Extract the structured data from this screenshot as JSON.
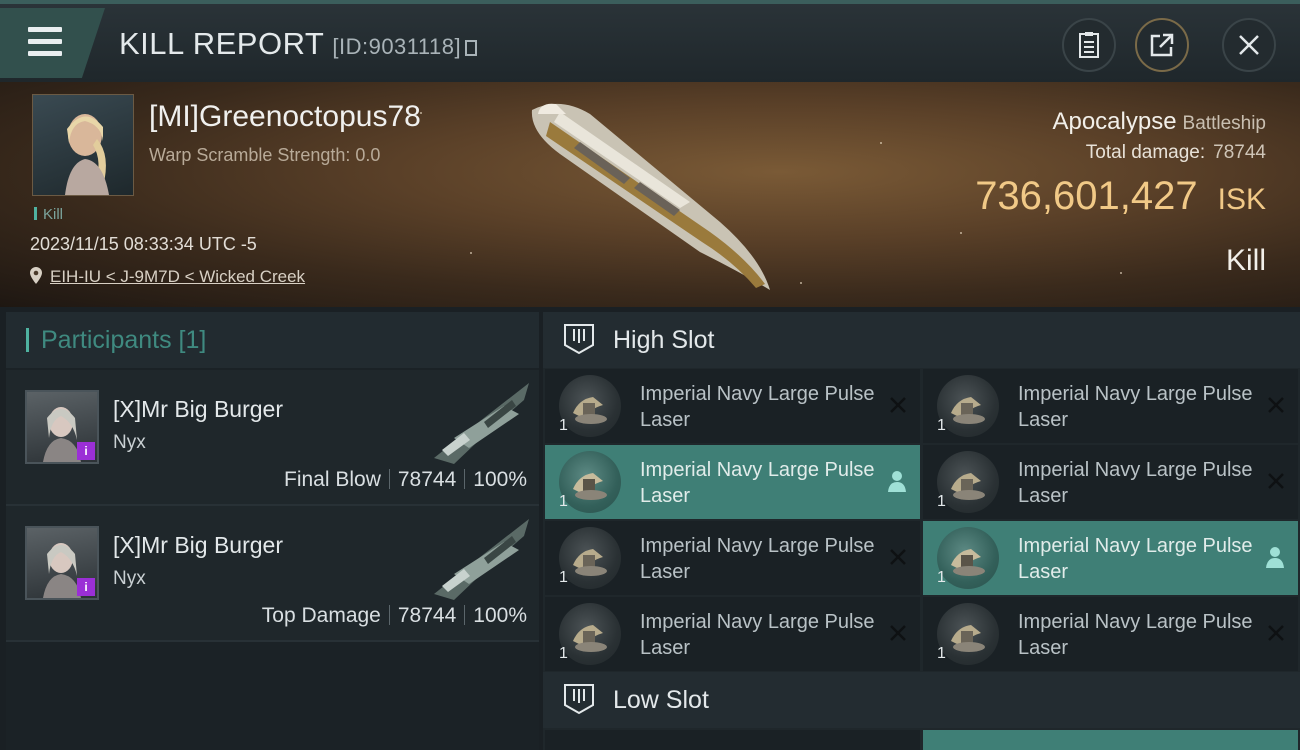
{
  "header": {
    "title": "KILL REPORT",
    "report_id": "[ID:9031118]"
  },
  "victim": {
    "name": "[MI]Greenoctopus78",
    "warp_scramble": "Warp Scramble Strength: 0.0",
    "kill_tag": "Kill",
    "datetime": "2023/11/15 08:33:34 UTC -5",
    "location": "EIH-IU < J-9M7D < Wicked Creek",
    "ship_name": "Apocalypse",
    "ship_class": "Battleship",
    "total_damage_label": "Total damage:",
    "total_damage": "78744",
    "isk_value": "736,601,427",
    "isk_unit": "ISK",
    "result": "Kill"
  },
  "participants": {
    "title": "Participants [1]",
    "rows": [
      {
        "name": "[X]Mr Big Burger",
        "ship": "Nyx",
        "role": "Final Blow",
        "damage": "78744",
        "percent": "100%"
      },
      {
        "name": "[X]Mr Big Burger",
        "ship": "Nyx",
        "role": "Top Damage",
        "damage": "78744",
        "percent": "100%"
      }
    ]
  },
  "high_slot": {
    "title": "High Slot",
    "modules": [
      {
        "qty": "1",
        "name": "Imperial Navy Large Pulse Laser",
        "state": "destroyed"
      },
      {
        "qty": "1",
        "name": "Imperial Navy Large Pulse Laser",
        "state": "destroyed"
      },
      {
        "qty": "1",
        "name": "Imperial Navy Large Pulse Laser",
        "state": "dropped"
      },
      {
        "qty": "1",
        "name": "Imperial Navy Large Pulse Laser",
        "state": "destroyed"
      },
      {
        "qty": "1",
        "name": "Imperial Navy Large Pulse Laser",
        "state": "destroyed"
      },
      {
        "qty": "1",
        "name": "Imperial Navy Large Pulse Laser",
        "state": "dropped"
      },
      {
        "qty": "1",
        "name": "Imperial Navy Large Pulse Laser",
        "state": "destroyed"
      },
      {
        "qty": "1",
        "name": "Imperial Navy Large Pulse Laser",
        "state": "destroyed"
      }
    ]
  },
  "low_slot": {
    "title": "Low Slot"
  },
  "colors": {
    "accent_teal": "#3f7f76",
    "isk_gold": "#f1c987",
    "badge_purple": "#9b2fd6"
  }
}
